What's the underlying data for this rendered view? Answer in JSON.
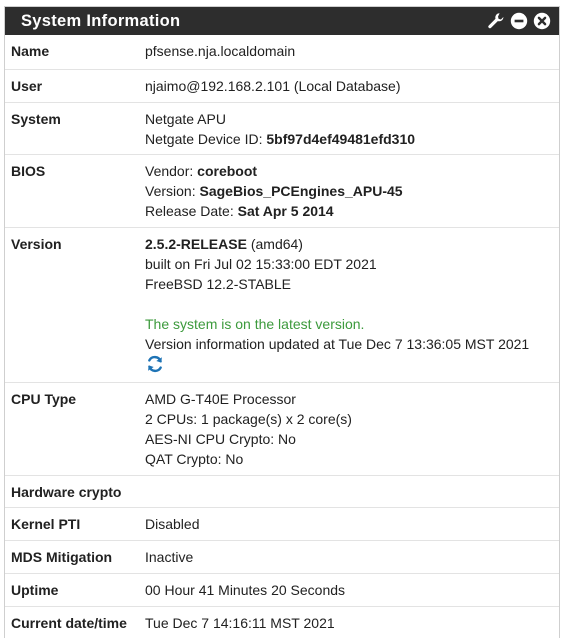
{
  "widget": {
    "title": "System Information"
  },
  "rows": {
    "name": {
      "label": "Name",
      "value": "pfsense.nja.localdomain"
    },
    "user": {
      "label": "User",
      "value": "njaimo@192.168.2.101 (Local Database)"
    },
    "system": {
      "label": "System",
      "model": "Netgate APU",
      "device_id_prefix": "Netgate Device ID: ",
      "device_id": "5bf97d4ef49481efd310"
    },
    "bios": {
      "label": "BIOS",
      "vendor_prefix": "Vendor: ",
      "vendor": "coreboot",
      "version_prefix": "Version: ",
      "version": "SageBios_PCEngines_APU-45",
      "release_prefix": "Release Date: ",
      "release": "Sat Apr 5 2014"
    },
    "version": {
      "label": "Version",
      "release": "2.5.2-RELEASE",
      "arch": " (amd64)",
      "built": "built on Fri Jul 02 15:33:00 EDT 2021",
      "freebsd": "FreeBSD 12.2-STABLE",
      "status": "The system is on the latest version.",
      "updated": "Version information updated at Tue Dec 7 13:36:05 MST 2021"
    },
    "cpu": {
      "label": "CPU Type",
      "model": "AMD G-T40E Processor",
      "cpus": "2 CPUs: 1 package(s) x 2 core(s)",
      "aesni": "AES-NI CPU Crypto: No",
      "qat": "QAT Crypto: No"
    },
    "hw_crypto": {
      "label": "Hardware crypto",
      "value": ""
    },
    "kernel_pti": {
      "label": "Kernel PTI",
      "value": "Disabled"
    },
    "mds": {
      "label": "MDS Mitigation",
      "value": "Inactive"
    },
    "uptime": {
      "label": "Uptime",
      "value": "00 Hour 41 Minutes 20 Seconds"
    },
    "datetime": {
      "label": "Current date/time",
      "value": "Tue Dec 7 14:16:11 MST 2021"
    }
  },
  "icons": {
    "wrench": "wrench-icon",
    "minimize": "minus-circle-icon",
    "close": "times-circle-icon",
    "refresh": "refresh-icon"
  },
  "colors": {
    "header_bg": "#2d2d2d",
    "ok_text": "#3c9a3c",
    "refresh_blue": "#1e73b5"
  }
}
